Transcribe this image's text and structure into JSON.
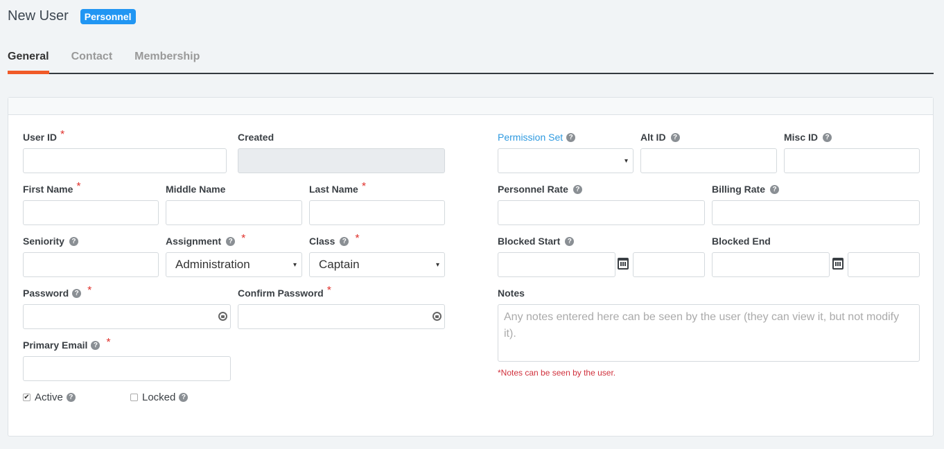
{
  "header": {
    "title": "New User",
    "badge": "Personnel"
  },
  "tabs": [
    {
      "label": "General",
      "active": true
    },
    {
      "label": "Contact",
      "active": false
    },
    {
      "label": "Membership",
      "active": false
    }
  ],
  "form": {
    "user_id": {
      "label": "User ID",
      "value": ""
    },
    "created": {
      "label": "Created",
      "value": ""
    },
    "first_name": {
      "label": "First Name",
      "value": ""
    },
    "middle_name": {
      "label": "Middle Name",
      "value": ""
    },
    "last_name": {
      "label": "Last Name",
      "value": ""
    },
    "seniority": {
      "label": "Seniority",
      "value": ""
    },
    "assignment": {
      "label": "Assignment",
      "value": "Administration"
    },
    "class": {
      "label": "Class",
      "value": "Captain"
    },
    "password": {
      "label": "Password",
      "value": ""
    },
    "confirm_password": {
      "label": "Confirm Password",
      "value": ""
    },
    "primary_email": {
      "label": "Primary Email",
      "value": ""
    },
    "active": {
      "label": "Active",
      "checked": true
    },
    "locked": {
      "label": "Locked",
      "checked": false
    },
    "permission_set": {
      "label": "Permission Set",
      "value": ""
    },
    "alt_id": {
      "label": "Alt ID",
      "value": ""
    },
    "misc_id": {
      "label": "Misc ID",
      "value": ""
    },
    "personnel_rate": {
      "label": "Personnel Rate",
      "value": ""
    },
    "billing_rate": {
      "label": "Billing Rate",
      "value": ""
    },
    "blocked_start": {
      "label": "Blocked Start",
      "date": "",
      "time": ""
    },
    "blocked_end": {
      "label": "Blocked End",
      "date": "",
      "time": ""
    },
    "notes": {
      "label": "Notes",
      "placeholder": "Any notes entered here can be seen by the user (they can view it, but not modify it).",
      "hint": "*Notes can be seen by the user."
    }
  },
  "symbols": {
    "required": "*",
    "help": "?",
    "caret": "▾",
    "check": "✔"
  }
}
